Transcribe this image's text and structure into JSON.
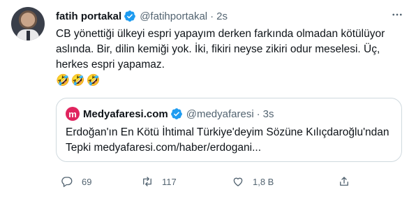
{
  "author": {
    "name": "fatih portakal",
    "handle": "@fatihportakal",
    "separator": "·",
    "time": "2s"
  },
  "tweet": {
    "text": "CB yönettiği ülkeyi espri yapayım derken farkında olmadan kötülüyor aslında. Bir, dilin kemiği yok. İki, fikiri neyse zikiri odur meselesi. Üç, herkes espri yapamaz.",
    "emojis": [
      "🤣",
      "🤣",
      "🤣"
    ]
  },
  "quote": {
    "logo_letter": "m",
    "name": "Medyafaresi.com",
    "handle": "@medyafaresi",
    "separator": "·",
    "time": "3s",
    "text": "Erdoğan'ın En Kötü İhtimal Türkiye'deyim Sözüne Kılıçdaroğlu'ndan Tepki medyafaresi.com/haber/erdogani..."
  },
  "actions": {
    "replies": "69",
    "retweets": "117",
    "likes": "1,8 B"
  },
  "icons": {
    "verified": "verified-badge-icon",
    "more": "more-dots-icon",
    "reply": "reply-icon",
    "retweet": "retweet-icon",
    "like": "heart-icon",
    "share": "share-icon"
  },
  "colors": {
    "verified": "#1d9bf0",
    "secondary_text": "#536471",
    "quote_logo": "#e0245e",
    "border": "#cfd9de"
  }
}
